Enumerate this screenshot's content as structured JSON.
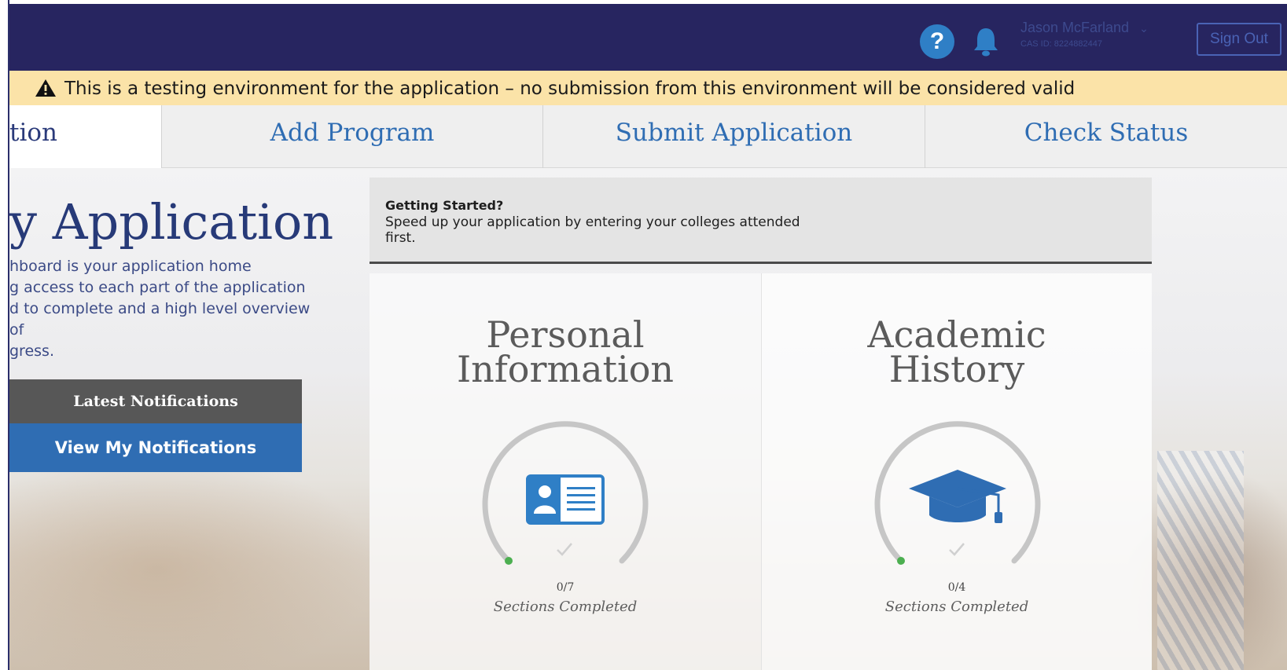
{
  "header": {
    "user_name": "Jason McFarland",
    "cas_id": "CAS ID: 8224882447",
    "sign_out_label": "Sign Out",
    "help_icon": "question-circle-icon",
    "bell_icon": "bell-icon",
    "chevron_icon": "chevron-down-icon"
  },
  "banner": {
    "icon": "warning-triangle-icon",
    "text": "This is a testing environment for the application – no submission from this environment will be considered valid"
  },
  "tabs": [
    {
      "label": "tion"
    },
    {
      "label": "Add Program"
    },
    {
      "label": "Submit Application"
    },
    {
      "label": "Check Status"
    }
  ],
  "intro": {
    "title": "y Application",
    "lines": [
      "hboard is your application home",
      "g access to each part of the application",
      "d to complete and a high level overview of",
      "gress."
    ]
  },
  "notifications": {
    "heading": "Latest Notifications",
    "button_label": "View My Notifications"
  },
  "getting_started": {
    "title": "Getting Started?",
    "line1": "Speed up your application by entering your colleges attended",
    "line2": "first."
  },
  "cards": [
    {
      "title_line1": "Personal",
      "title_line2": "Information",
      "icon": "id-card-icon",
      "progress_text": "0/7",
      "progress_fraction": 0,
      "subtitle": "Sections Completed"
    },
    {
      "title_line1": "Academic",
      "title_line2": "History",
      "icon": "graduation-cap-icon",
      "progress_text": "0/4",
      "progress_fraction": 0,
      "subtitle": "Sections Completed"
    }
  ],
  "colors": {
    "header_bg": "#272560",
    "banner_bg": "#fbe3a8",
    "accent_blue": "#2f6db3",
    "title_navy": "#273a78"
  }
}
